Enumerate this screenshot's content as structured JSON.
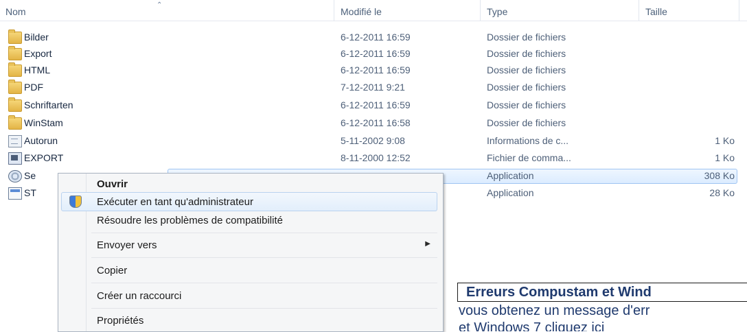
{
  "columns": {
    "name": "Nom",
    "modified": "Modifié le",
    "type": "Type",
    "size": "Taille"
  },
  "files": [
    {
      "name": "Bilder",
      "modified": "6-12-2011 16:59",
      "type": "Dossier de fichiers",
      "size": "",
      "icon": "folder-icon"
    },
    {
      "name": "Export",
      "modified": "6-12-2011 16:59",
      "type": "Dossier de fichiers",
      "size": "",
      "icon": "folder-icon"
    },
    {
      "name": "HTML",
      "modified": "6-12-2011 16:59",
      "type": "Dossier de fichiers",
      "size": "",
      "icon": "folder-icon"
    },
    {
      "name": "PDF",
      "modified": "7-12-2011 9:21",
      "type": "Dossier de fichiers",
      "size": "",
      "icon": "folder-icon"
    },
    {
      "name": "Schriftarten",
      "modified": "6-12-2011 16:59",
      "type": "Dossier de fichiers",
      "size": "",
      "icon": "folder-icon"
    },
    {
      "name": "WinStam",
      "modified": "6-12-2011 16:58",
      "type": "Dossier de fichiers",
      "size": "",
      "icon": "folder-icon"
    },
    {
      "name": "Autorun",
      "modified": "5-11-2002 9:08",
      "type": "Informations de c...",
      "size": "1 Ko",
      "icon": "settings-file-icon"
    },
    {
      "name": "EXPORT",
      "modified": "8-11-2000 12:52",
      "type": "Fichier de comma...",
      "size": "1 Ko",
      "icon": "command-file-icon"
    },
    {
      "name": "Se",
      "modified": "",
      "type": "Application",
      "size": "308 Ko",
      "icon": "setup-icon"
    },
    {
      "name": "ST",
      "modified": "",
      "type": "Application",
      "size": "28 Ko",
      "icon": "application-icon"
    }
  ],
  "context_menu": {
    "open": "Ouvrir",
    "run_as_admin": "Exécuter en tant qu'administrateur",
    "troubleshoot": "Résoudre les problèmes de compatibilité",
    "send_to": "Envoyer vers",
    "copy": "Copier",
    "create_shortcut": "Créer un raccourci",
    "properties": "Propriétés"
  },
  "notice": {
    "title": "Erreurs Compustam et Wind",
    "line1": "vous obtenez un message d'err",
    "line2": "et Windows 7 cliquez ici"
  },
  "colors": {
    "selection": "#dcecff",
    "menu_background": "#f5f6f7",
    "notice_text": "#1f3a6e"
  }
}
